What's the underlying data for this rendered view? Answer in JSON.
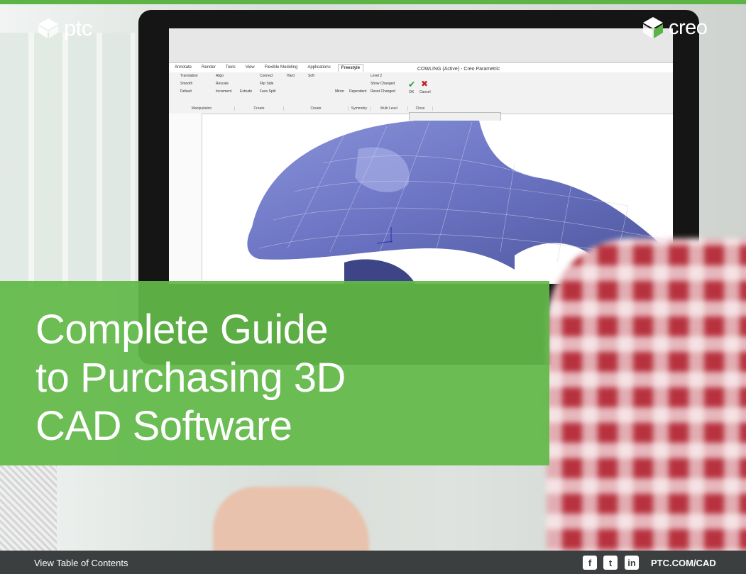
{
  "colors": {
    "brand_green": "#5cb446",
    "title_overlay": "#61b948",
    "footer_bg": "#3b3f3f",
    "text": "#ffffff"
  },
  "logos": {
    "ptc": {
      "text": "ptc",
      "icon": "ptc-cube-icon"
    },
    "creo": {
      "text": "creo",
      "icon": "creo-cube-icon"
    }
  },
  "screen": {
    "window_title": "COWLING (Active) - Creo Parametric",
    "tabs": [
      "Annotate",
      "Render",
      "Tools",
      "View",
      "Flexible Modeling",
      "Applications",
      "Freestyle"
    ],
    "active_tab": "Freestyle",
    "groups": [
      "Manipulation",
      "Create",
      "Create",
      "Symmetry",
      "Multi Level",
      "Close"
    ],
    "buttons": [
      "Translation",
      "Smooth",
      "Default",
      "Align",
      "Rescale",
      "Increment",
      "Extrude",
      "Connect",
      "Hard",
      "Soft",
      "Flip Side",
      "Face Split",
      "Mirror",
      "Dependent",
      "Level 2",
      "Show Changed",
      "Reset Changed",
      "OK",
      "Cancel"
    ]
  },
  "title": {
    "line1": "Complete Guide",
    "line2": "to Purchasing 3D",
    "line3": "CAD Software"
  },
  "footer": {
    "toc": "View Table of Contents",
    "url": "PTC.COM/CAD",
    "social": [
      "facebook-icon",
      "twitter-icon",
      "linkedin-icon"
    ]
  }
}
